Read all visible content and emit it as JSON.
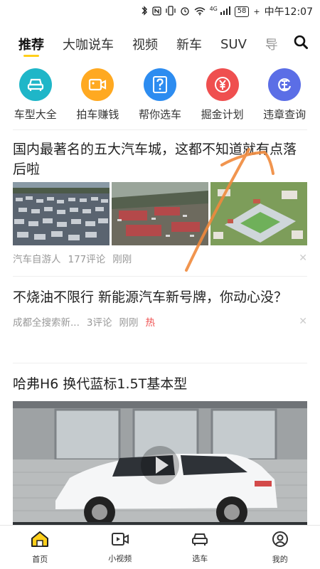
{
  "status_bar": {
    "icons": [
      "bluetooth-icon",
      "nfc-icon",
      "vibrate-icon",
      "alarm-icon",
      "wifi-icon",
      "signal-icon"
    ],
    "network": "4G",
    "battery": "58",
    "time": "中午12:07"
  },
  "tabs": [
    "推荐",
    "大咖说车",
    "视频",
    "新车",
    "SUV",
    "导"
  ],
  "quick_actions": [
    {
      "label": "车型大全",
      "color": "#1fb6c8",
      "icon": "car-icon"
    },
    {
      "label": "拍车赚钱",
      "color": "#ffa921",
      "icon": "video-camera-icon"
    },
    {
      "label": "帮你选车",
      "color": "#2d8cf0",
      "icon": "question-icon"
    },
    {
      "label": "掘金计划",
      "color": "#ef4f4f",
      "icon": "yen-icon"
    },
    {
      "label": "违章查询",
      "color": "#5b6ee6",
      "icon": "traffic-ticket-icon"
    }
  ],
  "articles": [
    {
      "title": "国内最著名的五大汽车城，这都不知道就有点落后啦",
      "source": "汽车自游人",
      "comments": "177评论",
      "time": "刚刚"
    },
    {
      "title": "不烧油不限行 新能源汽车新号牌，你动心没？",
      "source": "成都全搜索新...",
      "comments": "3评论",
      "time": "刚刚",
      "tag": "热"
    },
    {
      "title": "哈弗H6 换代蓝标1.5T基本型"
    }
  ],
  "bottom_nav": [
    {
      "label": "首页",
      "icon": "home-icon"
    },
    {
      "label": "小视频",
      "icon": "short-video-icon"
    },
    {
      "label": "选车",
      "icon": "car-select-icon"
    },
    {
      "label": "我的",
      "icon": "profile-icon"
    }
  ],
  "colors": {
    "accent": "#ffcf1a",
    "hot": "#ef4f4f",
    "annotation": "#f08a3c"
  }
}
